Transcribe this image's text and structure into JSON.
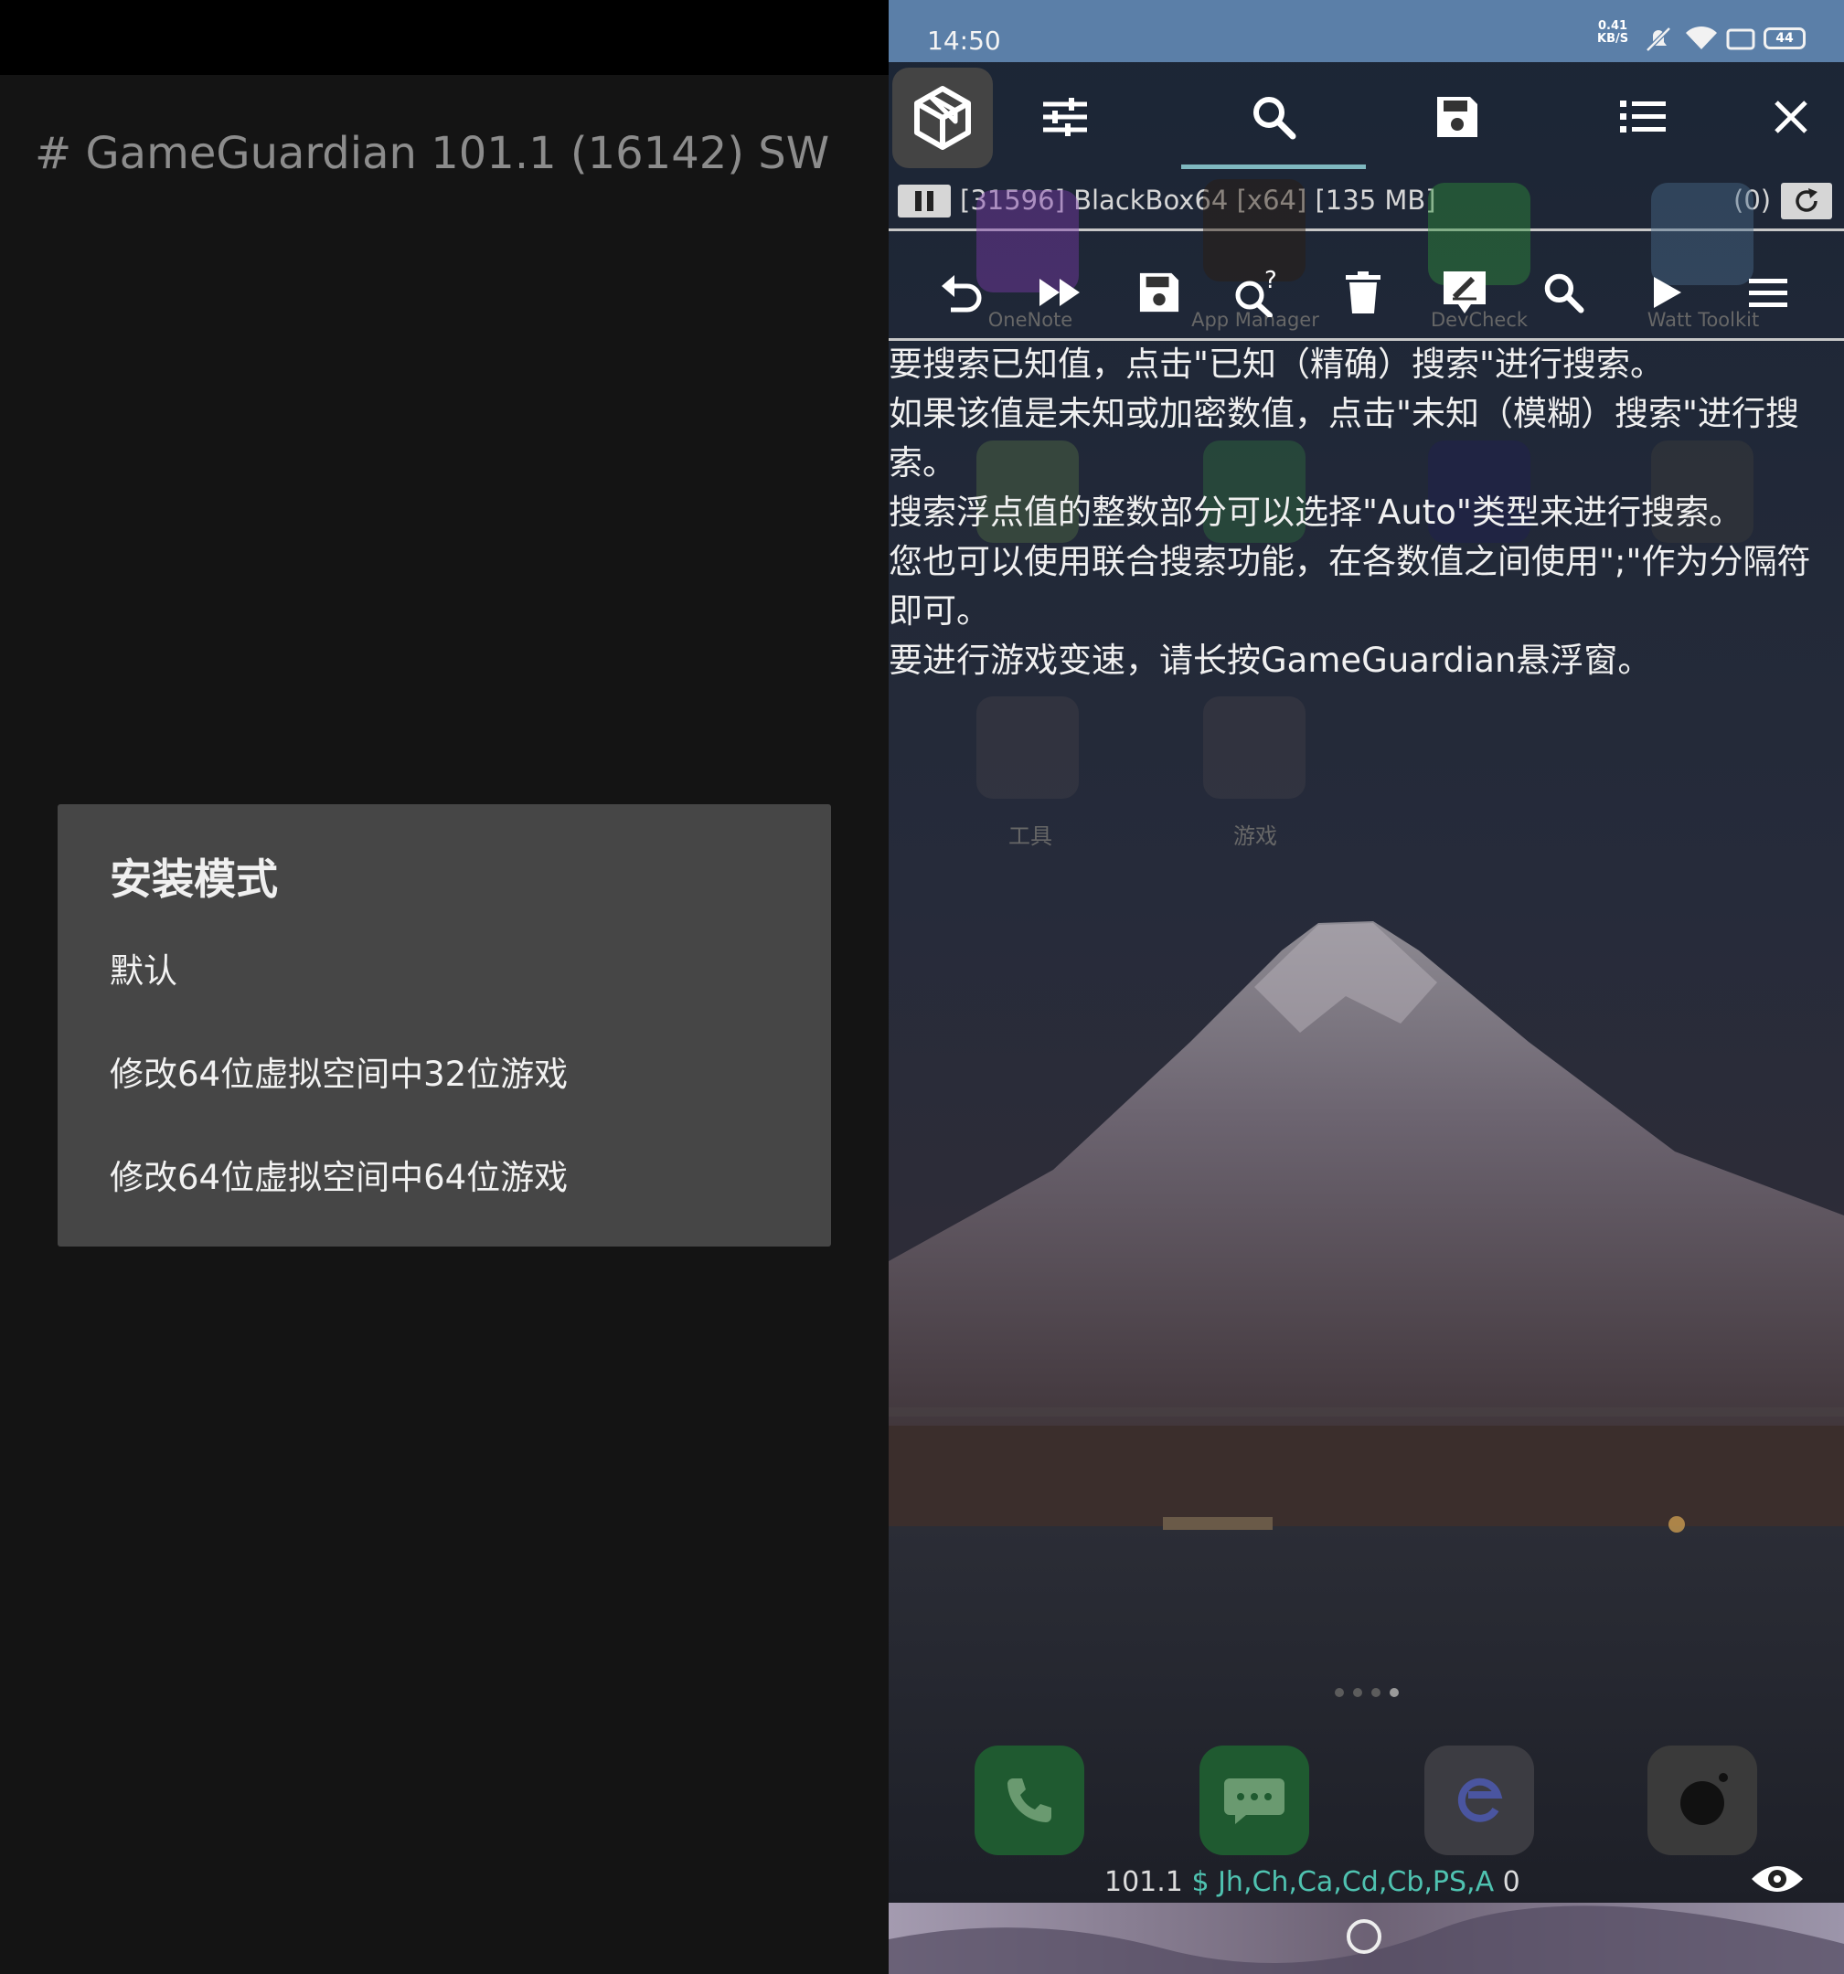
{
  "left_panel": {
    "header_title": "# GameGuardian 101.1 (16142) SW",
    "dialog": {
      "title": "安装模式",
      "options": [
        "默认",
        "修改64位虚拟空间中32位游戏",
        "修改64位虚拟空间中64位游戏"
      ]
    }
  },
  "right_panel": {
    "status_bar": {
      "time": "14:50",
      "net_speed_value": "0.41",
      "net_speed_unit": "KB/S",
      "battery": "44"
    },
    "toolbar": {
      "items": [
        "cube-logo",
        "sliders-icon",
        "search-icon",
        "save-icon",
        "list-icon",
        "close-icon"
      ],
      "active_tab": "search-icon"
    },
    "process_bar": {
      "process": "[31596] BlackBox64 [x64] [135 MB]",
      "count": "(0)"
    },
    "search_toolbar": {
      "items": [
        "undo-icon",
        "fast-forward-icon",
        "save-icon",
        "unknown-search-icon",
        "delete-icon",
        "edit-icon",
        "search-icon",
        "play-icon",
        "menu-icon"
      ]
    },
    "help_text": [
      "要搜索已知值，点击\"已知（精确）搜索\"进行搜索。",
      "如果该值是未知或加密数值，点击\"未知（模糊）搜索\"进行搜索。",
      "搜索浮点值的整数部分可以选择\"Auto\"类型来进行搜索。",
      "您也可以使用联合搜索功能，在各数值之间使用\";\"作为分隔符即可。",
      "要进行游戏变速，请长按GameGuardian悬浮窗。"
    ],
    "home_apps": [
      "OneNote",
      "App Manager",
      "DevCheck",
      "Watt Toolkit"
    ],
    "folders": [
      "工具",
      "游戏"
    ],
    "bottom_status": {
      "version": "101.1",
      "symbol": "$",
      "regions": "Jh,Ch,Ca,Cd,Cb,PS,A",
      "count": "0"
    },
    "colors": {
      "status_bar": "#5b7fa8",
      "accent_underline": "#7fb8c0",
      "region_text": "#4fc2b0",
      "dialog_bg": "#464646"
    }
  }
}
